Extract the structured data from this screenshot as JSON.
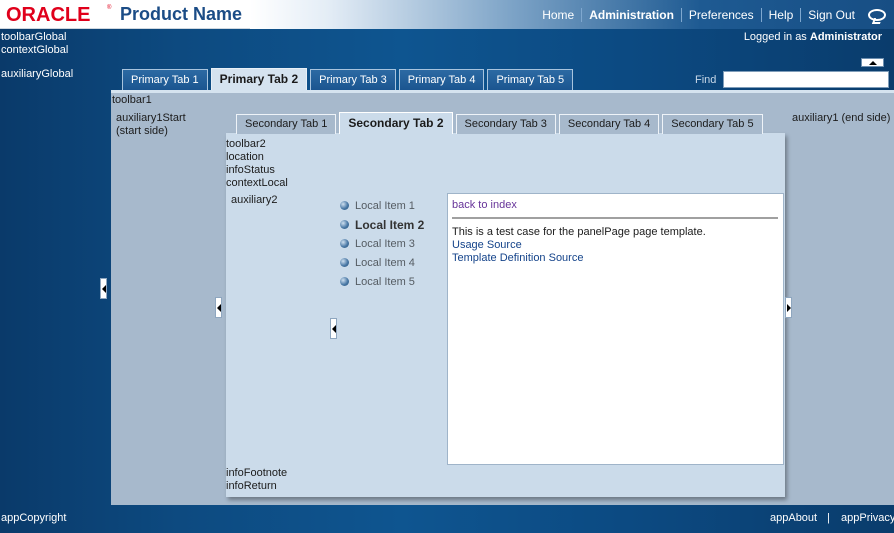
{
  "branding": {
    "logo_text": "ORACLE",
    "product_name": "Product Name"
  },
  "global_nav": {
    "items": [
      {
        "label": "Home",
        "active": false
      },
      {
        "label": "Administration",
        "active": true
      },
      {
        "label": "Preferences",
        "active": false
      },
      {
        "label": "Help",
        "active": false
      },
      {
        "label": "Sign Out",
        "active": false
      }
    ],
    "icon": "help-icon"
  },
  "global_facets": {
    "toolbar_global": "toolbarGlobal",
    "context_global": "contextGlobal",
    "auxiliary_global": "auxiliaryGlobal"
  },
  "user": {
    "prefix": "Logged in as",
    "name": "Administrator"
  },
  "primary_tabs": {
    "items": [
      {
        "label": "Primary Tab 1",
        "active": false
      },
      {
        "label": "Primary Tab 2",
        "active": true
      },
      {
        "label": "Primary Tab 3",
        "active": false
      },
      {
        "label": "Primary Tab 4",
        "active": false
      },
      {
        "label": "Primary Tab 5",
        "active": false
      }
    ]
  },
  "search": {
    "label": "Find",
    "value": ""
  },
  "main": {
    "toolbar1": "toolbar1",
    "auxiliary1_start_line1": "auxiliary1Start",
    "auxiliary1_start_line2": "(start side)",
    "auxiliary1_end": "auxiliary1 (end side)",
    "toolbar2": "toolbar2",
    "location": "location",
    "info_status": "infoStatus",
    "context_local": "contextLocal",
    "auxiliary2": "auxiliary2",
    "info_footnote": "infoFootnote",
    "info_return": "infoReturn"
  },
  "secondary_tabs": {
    "items": [
      {
        "label": "Secondary Tab 1",
        "active": false
      },
      {
        "label": "Secondary Tab 2",
        "active": true
      },
      {
        "label": "Secondary Tab 3",
        "active": false
      },
      {
        "label": "Secondary Tab 4",
        "active": false
      },
      {
        "label": "Secondary Tab 5",
        "active": false
      }
    ]
  },
  "local_nav": {
    "items": [
      {
        "label": "Local Item 1",
        "active": false
      },
      {
        "label": "Local Item 2",
        "active": true
      },
      {
        "label": "Local Item 3",
        "active": false
      },
      {
        "label": "Local Item 4",
        "active": false
      },
      {
        "label": "Local Item 5",
        "active": false
      }
    ]
  },
  "content": {
    "back_link": "back to index",
    "description": "This is a test case for the panelPage page template.",
    "usage_link": "Usage Source",
    "template_link": "Template Definition Source"
  },
  "footer": {
    "copyright": "appCopyright",
    "about": "appAbout",
    "separator": "|",
    "privacy": "appPrivacy"
  },
  "colors": {
    "brand_red": "#e0001b",
    "product_blue": "#1b4c86",
    "page_background": "#0d4a80",
    "panel_background": "#a7b9cc",
    "inner_panel_background": "#cbdbea",
    "visited_link": "#663399",
    "link": "#14438a"
  }
}
